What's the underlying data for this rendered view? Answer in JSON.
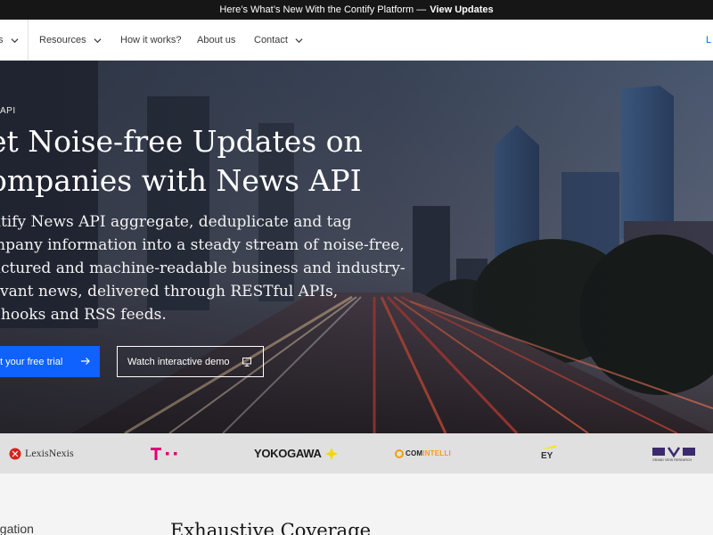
{
  "announcement": {
    "text": "Here’s What’s New With the Contify Platform —",
    "link": "View Updates"
  },
  "nav": {
    "items": [
      {
        "label": "s",
        "has_chevron": true
      },
      {
        "label": "Resources",
        "has_chevron": true
      },
      {
        "label": "How it works?",
        "has_chevron": false
      },
      {
        "label": "About us",
        "has_chevron": false
      },
      {
        "label": "Contact",
        "has_chevron": true
      }
    ],
    "right_label": "L"
  },
  "hero": {
    "eyebrow": "API",
    "headline_line1": "et Noise-free Updates on",
    "headline_line2": "ompanies with News API",
    "description_lines": [
      "ntify News API aggregate, deduplicate and tag",
      "mpany information into a steady stream of noise-free,",
      "uctured and machine-readable business and industry-",
      "evant news, delivered through RESTful APIs,",
      "bhooks and RSS feeds."
    ],
    "primary_cta": "t your free trial",
    "secondary_cta": "Watch interactive demo"
  },
  "logos": {
    "lexisnexis": "LexisNexis",
    "telekom": "T · ·",
    "yokogawa": "YOKOGAWA",
    "comintelli_prefix": "COM",
    "comintelli_suffix": "INTELLI",
    "ey": "EY",
    "gvr": "GVR",
    "gvr_caption": "GRAND VIEW RESEARCH"
  },
  "section": {
    "left_label": "egation",
    "title": "Exhaustive Coverage"
  },
  "colors": {
    "brand_blue": "#0f62fe",
    "announcement_bg": "#161616",
    "telekom_magenta": "#e20074",
    "yokogawa_yellow": "#f5d800",
    "ey_yellow": "#ffe600",
    "gvr_purple": "#3b2a6e"
  }
}
